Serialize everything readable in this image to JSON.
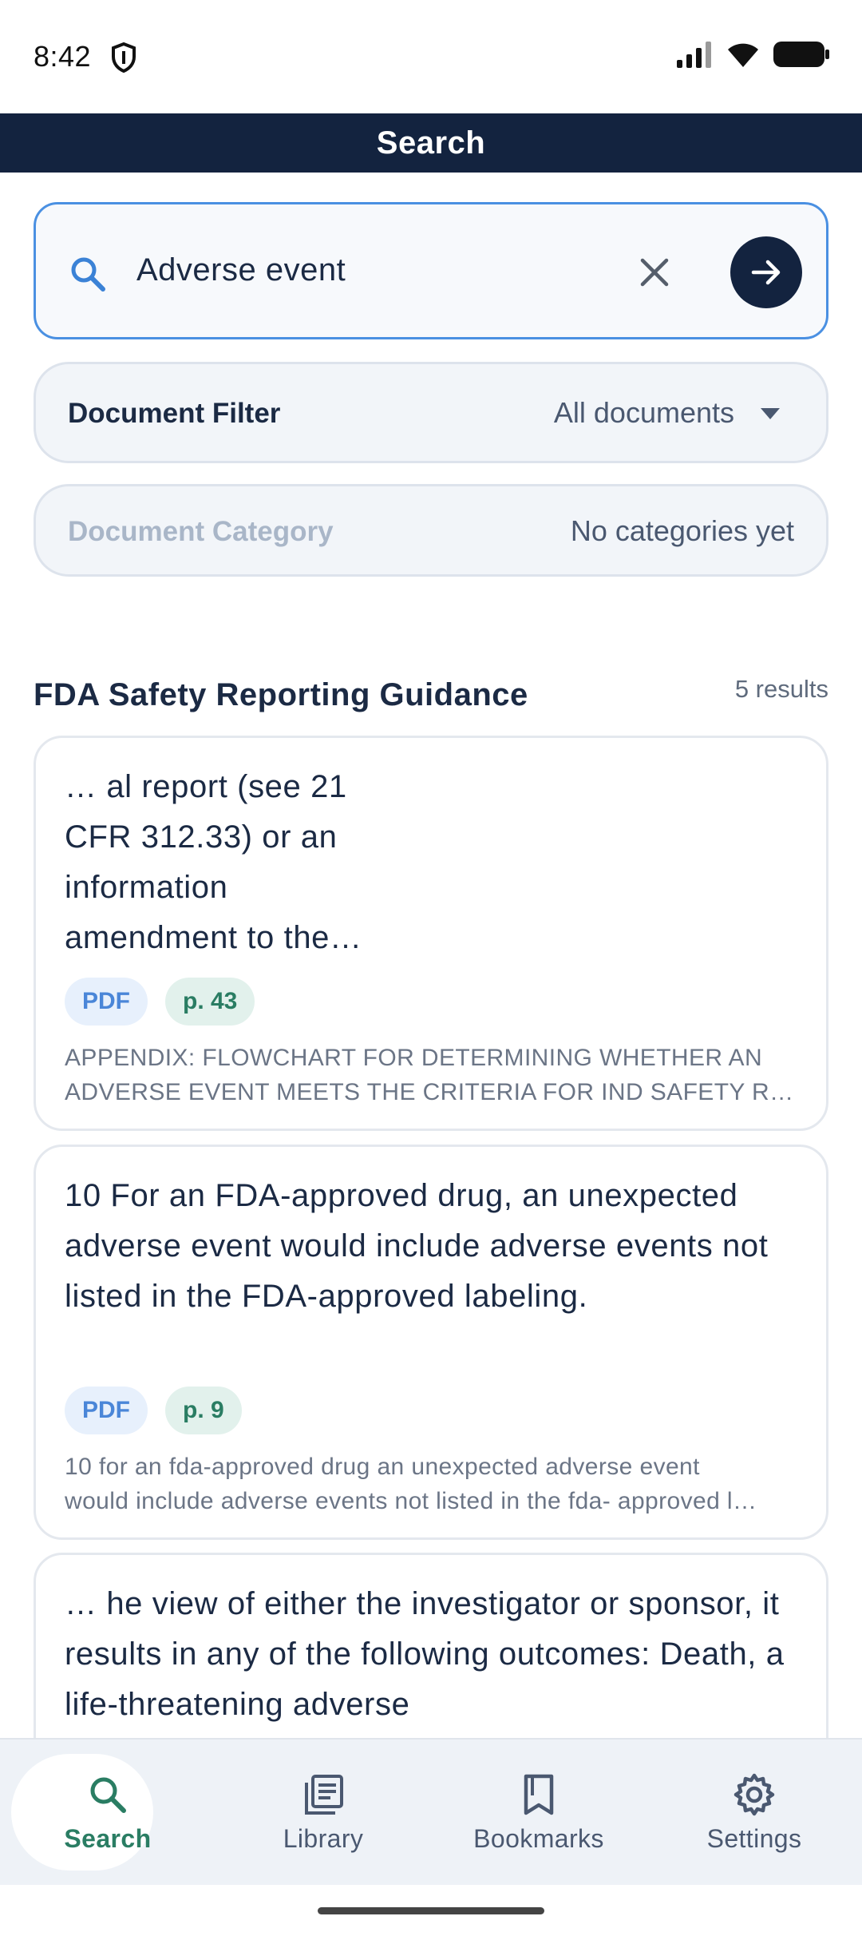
{
  "status_bar": {
    "time": "8:42"
  },
  "app_bar": {
    "title": "Search"
  },
  "search": {
    "query": "Adverse event"
  },
  "filters": {
    "document_filter": {
      "label": "Document Filter",
      "value": "All documents"
    },
    "document_category": {
      "label": "Document Category",
      "value": "No categories yet"
    }
  },
  "results": {
    "document_title": "FDA Safety Reporting Guidance",
    "count": "5 results",
    "items": [
      {
        "snippet": "… al report (see 21 CFR 312.33) or an information amendment to the…",
        "type": "PDF",
        "page": "p. 43",
        "context_line1": "APPENDIX: FLOWCHART FOR DETERMINING WHETHER AN",
        "context_line2": "ADVERSE EVENT MEETS THE CRITERIA FOR IND SAFETY RE…"
      },
      {
        "snippet": "10 For an FDA-approved drug, an unexpected adverse event would include adverse events not listed in the FDA-approved labeling.",
        "type": "PDF",
        "page": "p. 9",
        "context_line1": "10 for an fda-approved drug an unexpected adverse event",
        "context_line2": "would include adverse events not listed in the fda- approved l…"
      },
      {
        "snippet": "… he view of either the investigator or sponsor, it results in any of the following outcomes:  Death, a life-threatening adverse"
      }
    ]
  },
  "nav": {
    "items": [
      {
        "label": "Search",
        "icon": "search-icon",
        "active": true
      },
      {
        "label": "Library",
        "icon": "library-icon"
      },
      {
        "label": "Bookmarks",
        "icon": "bookmark-icon"
      },
      {
        "label": "Settings",
        "icon": "gear-icon"
      }
    ]
  },
  "colors": {
    "app_bar": "#13233f",
    "accent_blue": "#4a90e2",
    "active_green": "#2a7d63"
  }
}
